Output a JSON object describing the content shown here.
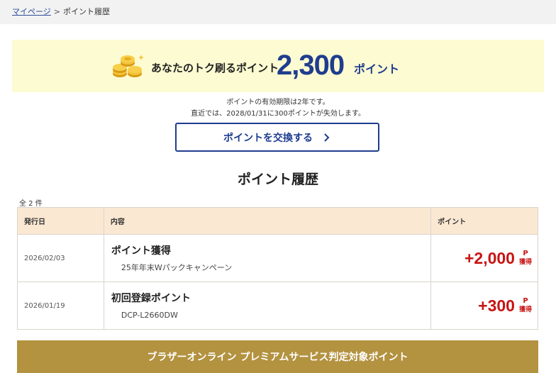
{
  "breadcrumb": {
    "parent": "マイページ",
    "separator": ">",
    "current": "ポイント履歴"
  },
  "banner": {
    "label": "あなたのトク刷るポイント",
    "value": "2,300",
    "unit": "ポイント"
  },
  "notes": {
    "line1": "ポイントの有効期限は2年です。",
    "line2": "直近では、2028/01/31に300ポイントが失効します。"
  },
  "exchange": {
    "label": "ポイントを交換する"
  },
  "history": {
    "title": "ポイント履歴",
    "count": "全 2 件",
    "headers": {
      "date": "発行日",
      "content": "内容",
      "points": "ポイント"
    },
    "rows": [
      {
        "date": "2026/02/03",
        "title": "ポイント獲得",
        "detail": "25年年末Wパックキャンペーン",
        "points": "+2,000",
        "unit": "P",
        "status": "獲得"
      },
      {
        "date": "2026/01/19",
        "title": "初回登録ポイント",
        "detail": "DCP-L2660DW",
        "points": "+300",
        "unit": "P",
        "status": "獲得"
      }
    ]
  },
  "premium": {
    "label": "ブラザーオンライン プレミアムサービス判定対象ポイント"
  },
  "colors": {
    "accent": "#1f3d8f",
    "points_red": "#c81414",
    "banner_bg": "#fdfbd1",
    "header_bg": "#fbe8d3",
    "premium_bg": "#b39240"
  },
  "icons": {
    "coins": "coins-icon",
    "chevron": "chevron-right-icon"
  }
}
